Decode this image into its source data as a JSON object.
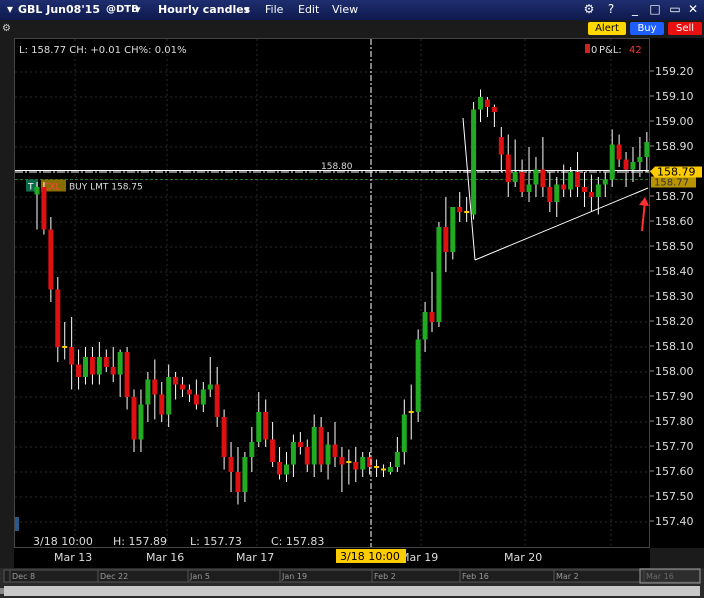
{
  "window": {
    "symbol": "GBL Jun08'15",
    "exchange": "@DTB",
    "timeframe": "Hourly candles",
    "menu": [
      "File",
      "Edit",
      "View"
    ]
  },
  "header_buttons": {
    "alert": "Alert",
    "buy": "Buy",
    "sell": "Sell"
  },
  "info_line": "L: 158.77 CH: +0.01 CH%: 0.01%",
  "position": {
    "pos": "0",
    "pnl_label": "P&L:",
    "pnl_value": "42"
  },
  "order_line": {
    "t": "T",
    "cxl": "CXL",
    "text": "BUY LMT 158.75",
    "price": 158.75
  },
  "hline": {
    "label": "158.80",
    "value": 158.8
  },
  "last_price_tag": "158.79",
  "hidden_tag": "158.77",
  "cursor_readout": {
    "time": "3/18 10:00",
    "h": "H: 157.89",
    "l": "L: 157.73",
    "c": "C: 157.83"
  },
  "cursor_x_label": "3/18 10:00",
  "x_axis_labels": [
    "Mar 13",
    "Mar 16",
    "Mar 17",
    "Mar 19",
    "Mar 20"
  ],
  "nav_labels": [
    "Dec 8",
    "Dec 22",
    "Jan 5",
    "Jan 19",
    "Feb 2",
    "Feb 16",
    "Mar 2",
    "Mar 16"
  ],
  "colors": {
    "up": "#22aa22",
    "down": "#dd1111",
    "accent": "#ffcc00",
    "price_tag": "#ffcc00"
  },
  "chart_data": {
    "type": "candlestick",
    "ylim": [
      157.33,
      159.27
    ],
    "y_ticks": [
      159.2,
      159.1,
      159.0,
      158.9,
      158.8,
      158.7,
      158.6,
      158.5,
      158.4,
      158.3,
      158.2,
      158.1,
      158.0,
      157.9,
      157.8,
      157.7,
      157.6,
      157.5,
      157.4
    ],
    "candles": [
      {
        "o": 158.71,
        "h": 158.76,
        "l": 158.57,
        "c": 158.74
      },
      {
        "o": 158.74,
        "h": 158.76,
        "l": 158.55,
        "c": 158.57
      },
      {
        "o": 158.57,
        "h": 158.62,
        "l": 158.28,
        "c": 158.33
      },
      {
        "o": 158.33,
        "h": 158.38,
        "l": 158.04,
        "c": 158.1
      },
      {
        "o": 158.1,
        "h": 158.2,
        "l": 158.05,
        "c": 158.1
      },
      {
        "o": 158.1,
        "h": 158.22,
        "l": 157.93,
        "c": 158.03
      },
      {
        "o": 158.03,
        "h": 158.09,
        "l": 157.93,
        "c": 157.98
      },
      {
        "o": 157.98,
        "h": 158.1,
        "l": 157.95,
        "c": 158.06
      },
      {
        "o": 158.06,
        "h": 158.1,
        "l": 157.95,
        "c": 157.99
      },
      {
        "o": 157.99,
        "h": 158.12,
        "l": 157.95,
        "c": 158.06
      },
      {
        "o": 158.06,
        "h": 158.09,
        "l": 158.0,
        "c": 158.02
      },
      {
        "o": 158.02,
        "h": 158.1,
        "l": 157.96,
        "c": 157.99
      },
      {
        "o": 157.99,
        "h": 158.09,
        "l": 157.9,
        "c": 158.08
      },
      {
        "o": 158.08,
        "h": 158.1,
        "l": 157.85,
        "c": 157.9
      },
      {
        "o": 157.9,
        "h": 157.93,
        "l": 157.68,
        "c": 157.73
      },
      {
        "o": 157.73,
        "h": 157.93,
        "l": 157.68,
        "c": 157.87
      },
      {
        "o": 157.87,
        "h": 158.0,
        "l": 157.8,
        "c": 157.97
      },
      {
        "o": 157.97,
        "h": 158.05,
        "l": 157.81,
        "c": 157.91
      },
      {
        "o": 157.91,
        "h": 157.96,
        "l": 157.8,
        "c": 157.83
      },
      {
        "o": 157.83,
        "h": 158.03,
        "l": 157.78,
        "c": 157.98
      },
      {
        "o": 157.98,
        "h": 158.0,
        "l": 157.89,
        "c": 157.95
      },
      {
        "o": 157.95,
        "h": 157.98,
        "l": 157.9,
        "c": 157.93
      },
      {
        "o": 157.93,
        "h": 157.95,
        "l": 157.88,
        "c": 157.91
      },
      {
        "o": 157.91,
        "h": 157.97,
        "l": 157.85,
        "c": 157.87
      },
      {
        "o": 157.87,
        "h": 157.96,
        "l": 157.84,
        "c": 157.93
      },
      {
        "o": 157.93,
        "h": 158.06,
        "l": 157.9,
        "c": 157.95
      },
      {
        "o": 157.95,
        "h": 158.02,
        "l": 157.78,
        "c": 157.82
      },
      {
        "o": 157.82,
        "h": 157.85,
        "l": 157.61,
        "c": 157.66
      },
      {
        "o": 157.66,
        "h": 157.72,
        "l": 157.52,
        "c": 157.6
      },
      {
        "o": 157.6,
        "h": 157.7,
        "l": 157.47,
        "c": 157.52
      },
      {
        "o": 157.52,
        "h": 157.68,
        "l": 157.48,
        "c": 157.66
      },
      {
        "o": 157.66,
        "h": 157.78,
        "l": 157.6,
        "c": 157.72
      },
      {
        "o": 157.72,
        "h": 157.92,
        "l": 157.7,
        "c": 157.84
      },
      {
        "o": 157.84,
        "h": 157.89,
        "l": 157.7,
        "c": 157.73
      },
      {
        "o": 157.73,
        "h": 157.8,
        "l": 157.62,
        "c": 157.64
      },
      {
        "o": 157.64,
        "h": 157.7,
        "l": 157.57,
        "c": 157.59
      },
      {
        "o": 157.59,
        "h": 157.68,
        "l": 157.56,
        "c": 157.63
      },
      {
        "o": 157.63,
        "h": 157.75,
        "l": 157.58,
        "c": 157.72
      },
      {
        "o": 157.72,
        "h": 157.76,
        "l": 157.67,
        "c": 157.7
      },
      {
        "o": 157.7,
        "h": 157.73,
        "l": 157.6,
        "c": 157.63
      },
      {
        "o": 157.63,
        "h": 157.83,
        "l": 157.58,
        "c": 157.78
      },
      {
        "o": 157.78,
        "h": 157.82,
        "l": 157.6,
        "c": 157.63
      },
      {
        "o": 157.63,
        "h": 157.76,
        "l": 157.57,
        "c": 157.71
      },
      {
        "o": 157.71,
        "h": 157.8,
        "l": 157.62,
        "c": 157.66
      },
      {
        "o": 157.66,
        "h": 157.7,
        "l": 157.52,
        "c": 157.63
      },
      {
        "o": 157.63,
        "h": 157.69,
        "l": 157.55,
        "c": 157.64
      },
      {
        "o": 157.64,
        "h": 157.7,
        "l": 157.56,
        "c": 157.61
      },
      {
        "o": 157.61,
        "h": 157.68,
        "l": 157.58,
        "c": 157.66
      },
      {
        "o": 157.66,
        "h": 157.68,
        "l": 157.59,
        "c": 157.62
      },
      {
        "o": 157.62,
        "h": 157.65,
        "l": 157.58,
        "c": 157.61
      },
      {
        "o": 157.61,
        "h": 157.63,
        "l": 157.58,
        "c": 157.6
      },
      {
        "o": 157.6,
        "h": 157.64,
        "l": 157.59,
        "c": 157.62
      },
      {
        "o": 157.62,
        "h": 157.74,
        "l": 157.6,
        "c": 157.68
      },
      {
        "o": 157.68,
        "h": 157.89,
        "l": 157.63,
        "c": 157.83
      },
      {
        "o": 157.83,
        "h": 157.95,
        "l": 157.73,
        "c": 157.84
      },
      {
        "o": 157.84,
        "h": 158.17,
        "l": 157.8,
        "c": 158.13
      },
      {
        "o": 158.13,
        "h": 158.28,
        "l": 158.08,
        "c": 158.24
      },
      {
        "o": 158.24,
        "h": 158.4,
        "l": 158.16,
        "c": 158.2
      },
      {
        "o": 158.2,
        "h": 158.6,
        "l": 158.18,
        "c": 158.58
      },
      {
        "o": 158.58,
        "h": 158.7,
        "l": 158.4,
        "c": 158.48
      },
      {
        "o": 158.48,
        "h": 158.65,
        "l": 158.45,
        "c": 158.66
      },
      {
        "o": 158.66,
        "h": 158.72,
        "l": 158.6,
        "c": 158.64
      },
      {
        "o": 158.64,
        "h": 158.7,
        "l": 158.6,
        "c": 158.63
      },
      {
        "o": 158.63,
        "h": 159.08,
        "l": 158.61,
        "c": 159.05
      },
      {
        "o": 159.05,
        "h": 159.13,
        "l": 159.0,
        "c": 159.1
      },
      {
        "o": 159.09,
        "h": 159.1,
        "l": 159.02,
        "c": 159.06
      },
      {
        "o": 159.06,
        "h": 159.07,
        "l": 158.98,
        "c": 159.04
      },
      {
        "o": 158.94,
        "h": 158.98,
        "l": 158.8,
        "c": 158.87
      },
      {
        "o": 158.87,
        "h": 158.95,
        "l": 158.7,
        "c": 158.76
      },
      {
        "o": 158.76,
        "h": 158.93,
        "l": 158.74,
        "c": 158.8
      },
      {
        "o": 158.8,
        "h": 158.85,
        "l": 158.7,
        "c": 158.72
      },
      {
        "o": 158.72,
        "h": 158.9,
        "l": 158.68,
        "c": 158.75
      },
      {
        "o": 158.75,
        "h": 158.86,
        "l": 158.7,
        "c": 158.81
      },
      {
        "o": 158.81,
        "h": 158.94,
        "l": 158.7,
        "c": 158.74
      },
      {
        "o": 158.74,
        "h": 158.8,
        "l": 158.64,
        "c": 158.68
      },
      {
        "o": 158.68,
        "h": 158.78,
        "l": 158.62,
        "c": 158.75
      },
      {
        "o": 158.75,
        "h": 158.83,
        "l": 158.7,
        "c": 158.73
      },
      {
        "o": 158.73,
        "h": 158.82,
        "l": 158.7,
        "c": 158.8
      },
      {
        "o": 158.8,
        "h": 158.88,
        "l": 158.7,
        "c": 158.74
      },
      {
        "o": 158.74,
        "h": 158.8,
        "l": 158.66,
        "c": 158.72
      },
      {
        "o": 158.72,
        "h": 158.79,
        "l": 158.64,
        "c": 158.7
      },
      {
        "o": 158.7,
        "h": 158.78,
        "l": 158.63,
        "c": 158.75
      },
      {
        "o": 158.75,
        "h": 158.8,
        "l": 158.7,
        "c": 158.77
      },
      {
        "o": 158.77,
        "h": 158.97,
        "l": 158.74,
        "c": 158.91
      },
      {
        "o": 158.91,
        "h": 158.95,
        "l": 158.82,
        "c": 158.85
      },
      {
        "o": 158.85,
        "h": 158.88,
        "l": 158.74,
        "c": 158.81
      },
      {
        "o": 158.81,
        "h": 158.9,
        "l": 158.76,
        "c": 158.84
      },
      {
        "o": 158.84,
        "h": 158.94,
        "l": 158.78,
        "c": 158.86
      },
      {
        "o": 158.86,
        "h": 158.96,
        "l": 158.8,
        "c": 158.92
      },
      {
        "o": 158.92,
        "h": 158.95,
        "l": 158.8,
        "c": 158.85
      },
      {
        "o": 158.85,
        "h": 158.96,
        "l": 158.82,
        "c": 158.9
      },
      {
        "o": 158.9,
        "h": 158.92,
        "l": 158.8,
        "c": 158.86
      },
      {
        "o": 158.86,
        "h": 158.9,
        "l": 158.74,
        "c": 158.79
      }
    ]
  }
}
